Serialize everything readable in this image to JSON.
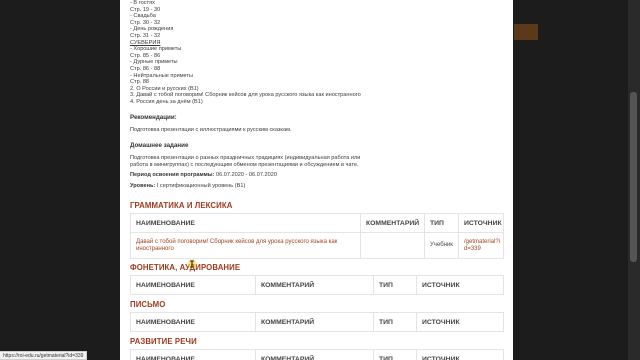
{
  "top_list": [
    "- В гостях",
    "Стр. 19 - 30",
    "- Свадьба",
    "Стр. 30 - 32",
    "- День рождения",
    "Стр. 31 - 32"
  ],
  "superstitions_heading": "СУЕВЕРИЯ",
  "superstition_list": [
    "- Хорошие приметы",
    "Стр. 85 - 86",
    "- Дурные приметы",
    "Стр. 86 - 88",
    "- Нейтральные приметы",
    "Стр. 88",
    "2. О России и русских (В1)",
    "3. Давай с тобой поговорим! Сборник кейсов для урока русского языка как иностранного",
    "4. Россия день за днём (В1)"
  ],
  "recommendations": {
    "heading": "Рекомендации:",
    "text": "Подготовка презентации с иллюстрациями к русским сказкам."
  },
  "homework": {
    "heading": "Домашнее задание",
    "text": "Подготовка презентации о разных праздничных традициях (индивидуальная работа или работа в минигруппах) с последующим обменом презентациями и обсуждением в чате."
  },
  "period": {
    "label": "Период освоения программы:",
    "value": "06.07.2020 - 06.07.2020"
  },
  "level": {
    "label": "Уровень:",
    "value": "I сертификационный уровень (В1)"
  },
  "sections": {
    "grammar": {
      "title": "ГРАММАТИКА И ЛЕКСИКА",
      "headers": [
        "НАИМЕНОВАНИЕ",
        "КОММЕНТАРИЙ",
        "ТИП",
        "ИСТОЧНИК"
      ],
      "row": {
        "name": "Давай с тобой поговорим! Сборник кейсов для урока русского языка как иностранного",
        "comment": "",
        "type": "Учебник",
        "source": "/getmaterial?id=339"
      }
    },
    "phonetics": {
      "title": "ФОНЕТИКА, АУДИРОВАНИЕ",
      "headers": [
        "НАИМЕНОВАНИЕ",
        "КОММЕНТАРИЙ",
        "ТИП",
        "ИСТОЧНИК"
      ]
    },
    "writing": {
      "title": "ПИСЬМО",
      "headers": [
        "НАИМЕНОВАНИЕ",
        "КОММЕНТАРИЙ",
        "ТИП",
        "ИСТОЧНИК"
      ]
    },
    "speech": {
      "title": "РАЗВИТИЕ РЕЧИ",
      "headers": [
        "НАИМЕНОВАНИЕ",
        "КОММЕНТАРИЙ",
        "ТИП",
        "ИСТОЧНИК"
      ]
    }
  },
  "status_url": "https://roi-edu.ru/getmaterial?id=339",
  "colors": {
    "accent": "#9c3b1e",
    "link": "#a24523",
    "backdrop": "#1c1c1c"
  }
}
